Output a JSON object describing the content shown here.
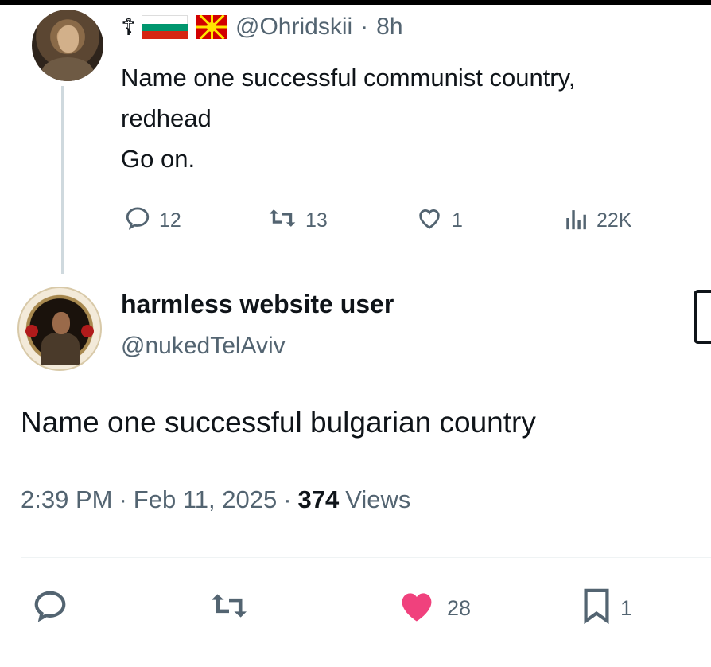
{
  "parent_tweet": {
    "handle": "@Ohridskii",
    "separator": "·",
    "time": "8h",
    "cross_glyph": "☦",
    "text_lines": [
      "Name one successful communist country,",
      "redhead",
      "Go on."
    ],
    "actions": {
      "replies": "12",
      "reposts": "13",
      "likes": "1",
      "views": "22K"
    }
  },
  "reply_tweet": {
    "display_name": "harmless website user",
    "handle": "@nukedTelAviv",
    "text": "Name one successful bulgarian country",
    "time": "2:39 PM",
    "sep1": "·",
    "date": "Feb 11, 2025",
    "sep2": "·",
    "views_count": "374",
    "views_label": "Views",
    "actions": {
      "likes": "28",
      "bookmarks": "1"
    }
  },
  "colors": {
    "text": "#0f1419",
    "secondary": "#536471",
    "like_pink": "#f0417d",
    "thread_line": "#cfd9de"
  },
  "icons": [
    "reply-icon",
    "repost-icon",
    "like-icon",
    "views-icon",
    "bookmark-icon",
    "grok-icon"
  ]
}
